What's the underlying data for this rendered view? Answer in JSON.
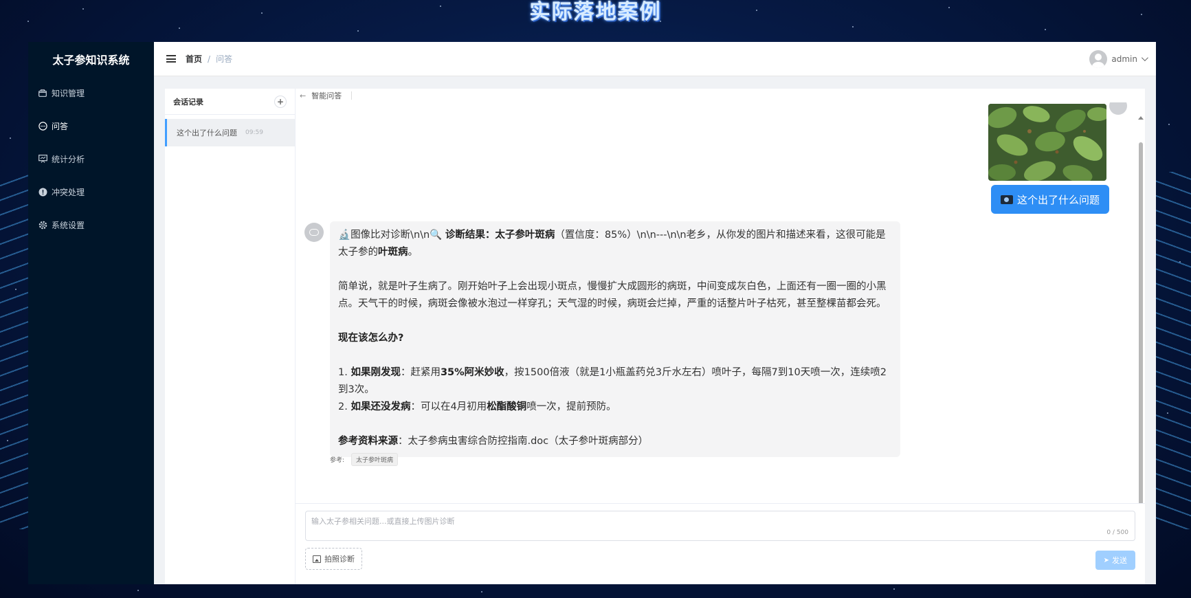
{
  "banner": {
    "title": "实际落地案例"
  },
  "app": {
    "name": "太子参知识系统"
  },
  "sidebar": {
    "items": [
      {
        "label": "知识管理",
        "icon": "folder-icon"
      },
      {
        "label": "问答",
        "icon": "chat-icon"
      },
      {
        "label": "统计分析",
        "icon": "chart-icon"
      },
      {
        "label": "冲突处理",
        "icon": "warning-icon"
      },
      {
        "label": "系统设置",
        "icon": "gear-icon"
      }
    ],
    "active": "问答"
  },
  "header": {
    "breadcrumb": {
      "home": "首页",
      "separator": "/",
      "current": "问答"
    },
    "user": "admin"
  },
  "sessions": {
    "title": "会话记录",
    "add": "+",
    "items": [
      {
        "title": "这个出了什么问题",
        "time": "09:59"
      }
    ]
  },
  "chat": {
    "title": "智能问答",
    "user_message": "这个出了什么问题",
    "bot": {
      "line1_icon": "🔬",
      "line1_a": "图像比对诊断\\n\\n🔍 ",
      "line1_b": "诊断结果：太子参叶斑病",
      "line1_c": "（置信度：85%）\\n\\n---\\n\\n老乡，从你发的图片和描述来看，这很可能是太子参的",
      "line1_d": "叶斑病",
      "line1_e": "。",
      "para2": "简单说，就是叶子生病了。刚开始叶子上会出现小斑点，慢慢扩大成圆形的病斑，中间变成灰白色，上面还有一圈一圈的小黑点。天气干的时候，病斑会像被水泡过一样穿孔；天气湿的时候，病斑会烂掉，严重的话整片叶子枯死，甚至整棵苗都会死。",
      "heading": "现在该怎么办?",
      "step1_num": "1. ",
      "step1_label": "如果刚发现",
      "step1_a": "：赶紧用",
      "step1_drug": "35%阿米妙收",
      "step1_b": "，按1500倍液（就是1小瓶盖药兑3斤水左右）喷叶子，每隔7到10天喷一次，连续喷2到3次。",
      "step2_num": "2. ",
      "step2_label": "如果还没发病",
      "step2_a": "：可以在4月初用",
      "step2_drug": "松酯酸铜",
      "step2_b": "喷一次，提前预防。",
      "source_label": "参考资料来源",
      "source_text": "：太子参病虫害综合防控指南.doc（太子参叶斑病部分）"
    },
    "refs_label": "参考:",
    "refs": [
      "太子参叶斑病"
    ]
  },
  "composer": {
    "placeholder": "输入太子参相关问题...或直接上传图片诊断",
    "counter": "0 / 500",
    "photo_button": "拍照诊断",
    "send_button": "发送"
  },
  "colors": {
    "sidebar_bg": "#001529",
    "primary": "#2e8ef5",
    "send_disabled": "#a0cfff"
  }
}
